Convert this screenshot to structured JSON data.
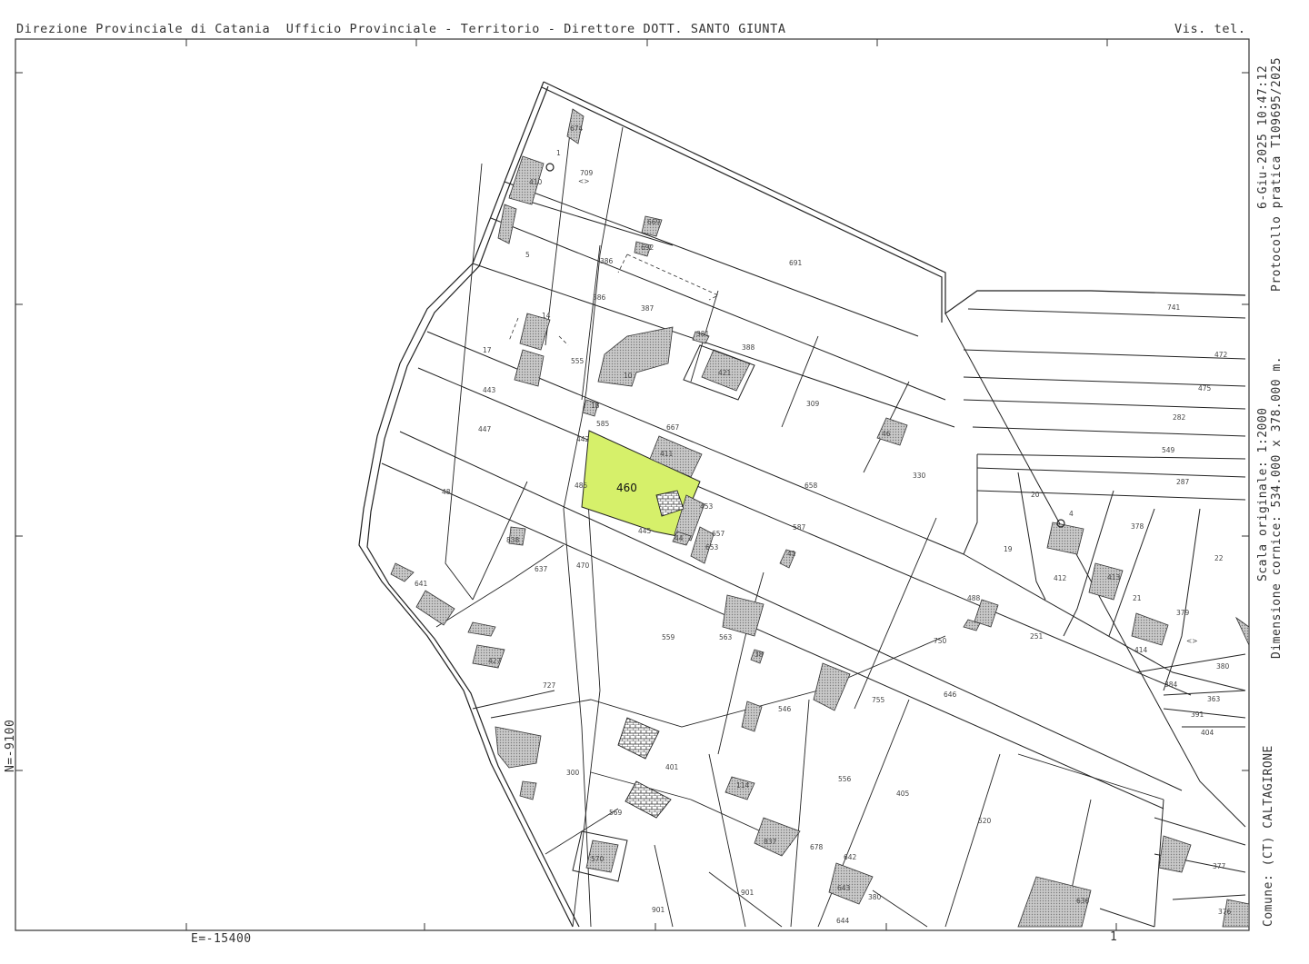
{
  "header": {
    "left": "Direzione Provinciale di Catania  Ufficio Provinciale - Territorio - Direttore DOTT. SANTO GIUNTA",
    "right": "Vis. tel."
  },
  "side": {
    "line1": "6-Giu-2025 10:47:12",
    "line2": "Protocollo pratica T109695/2025",
    "scale": "Scala originale: 1:2000",
    "dims": "Dimensione cornice: 534.000 x 378.000 m.",
    "comune": "Comune: (CT) CALTAGIRONE"
  },
  "coords": {
    "north": "N=-9100",
    "east": "E=-15400",
    "page": "1"
  },
  "map": {
    "highlight_parcel": "460",
    "highlight_color": "#d6f06a",
    "parcels": [
      "674",
      "410",
      "709",
      "5",
      "669",
      "692",
      "691",
      "386",
      "386",
      "387",
      "14",
      "381",
      "388",
      "421",
      "17",
      "555",
      "10",
      "443",
      "309",
      "18",
      "585",
      "442",
      "447",
      "667",
      "411",
      "46",
      "330",
      "460",
      "658",
      "48",
      "485",
      "453",
      "445",
      "44",
      "587",
      "657",
      "653",
      "20",
      "378",
      "838",
      "41",
      "637",
      "470",
      "19",
      "412",
      "413",
      "21",
      "22",
      "641",
      "488",
      "559",
      "563",
      "379",
      "414",
      "750",
      "251",
      "427",
      "38",
      "727",
      "380",
      "384",
      "363",
      "755",
      "646",
      "546",
      "391",
      "404",
      "300",
      "401",
      "114",
      "556",
      "405",
      "520",
      "569",
      "837",
      "678",
      "377",
      "570",
      "642",
      "643",
      "636",
      "380",
      "901",
      "376",
      "644",
      "741",
      "472",
      "475",
      "282",
      "549",
      "287"
    ],
    "markers": [
      "1",
      "4"
    ],
    "symbols": [
      "<>",
      "<>"
    ]
  }
}
